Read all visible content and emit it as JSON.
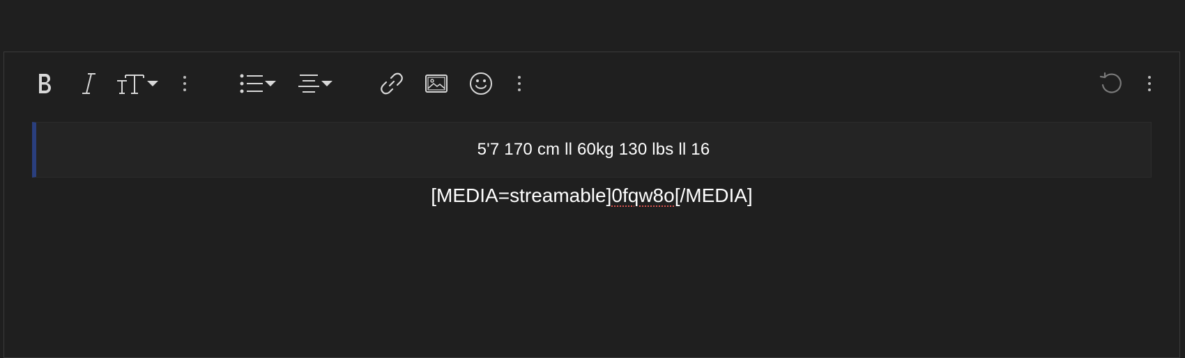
{
  "toolbar": {
    "buttons": [
      {
        "name": "bold",
        "icon": "bold-icon"
      },
      {
        "name": "italic",
        "icon": "italic-icon"
      },
      {
        "name": "text-size",
        "icon": "text-size-icon",
        "dropdown": true
      },
      {
        "name": "more-text-options",
        "icon": "more-vertical-icon"
      },
      {
        "name": "list",
        "icon": "list-icon",
        "dropdown": true
      },
      {
        "name": "align",
        "icon": "align-icon",
        "dropdown": true
      },
      {
        "name": "link",
        "icon": "link-icon"
      },
      {
        "name": "image",
        "icon": "image-icon"
      },
      {
        "name": "emoji",
        "icon": "smiley-icon"
      },
      {
        "name": "more-insert-options",
        "icon": "more-vertical-icon"
      },
      {
        "name": "undo",
        "icon": "undo-icon",
        "disabled": true
      },
      {
        "name": "more-options",
        "icon": "more-vertical-icon"
      }
    ]
  },
  "content": {
    "quote_text": "5'7 170 cm ll 60kg 130 lbs ll 16",
    "media_prefix": "[MEDIA=streamable]",
    "media_id": "0fqw8o",
    "media_suffix": "[/MEDIA]"
  },
  "colors": {
    "background": "#1f1f1f",
    "quote_bar": "#2a3f7e",
    "spellcheck": "#d9534f",
    "icon": "#d8d8d8",
    "icon_disabled": "#7a7a7a"
  }
}
